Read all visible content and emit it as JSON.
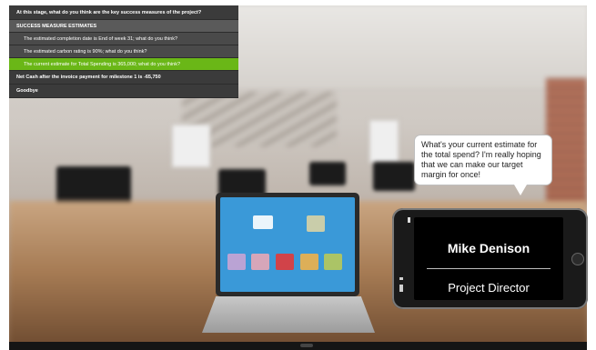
{
  "menu": {
    "header": "At this stage, what do you think are the key success measures of the project?",
    "section": "SUCCESS MEASURE ESTIMATES",
    "options": [
      {
        "label": "The estimated completion date is End of week 31; what do you think?"
      },
      {
        "label": "The estimated carbon rating is 90%; what do you think?"
      },
      {
        "label": "The current estimate for Total Spending is 365,000; what do you think?"
      }
    ],
    "net_cash": "Net Cash after the invoice payment for milestone 1 is -65,750",
    "goodbye": "Goodbye"
  },
  "speech": {
    "text": "What's your current estimate for the total spend? I'm really hoping that we can make our target margin for once!"
  },
  "contact": {
    "name": "Mike Denison",
    "role": "Project Director"
  },
  "colors": {
    "active_option": "#6ab717",
    "menu_dark": "#3b3b3b",
    "laptop_screen": "#3a99d8"
  }
}
